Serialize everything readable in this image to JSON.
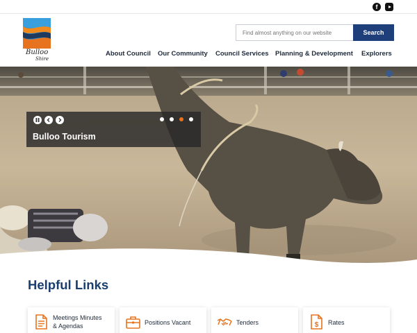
{
  "social": {
    "facebook_icon": "facebook-icon",
    "youtube_icon": "youtube-icon"
  },
  "header": {
    "logo_line1": "Bulloo",
    "logo_line2": "Shire",
    "search": {
      "placeholder": "Find almost anything on our website",
      "button_label": "Search"
    },
    "nav": [
      "About Council",
      "Our Community",
      "Council Services",
      "Planning & Development",
      "Explorers"
    ]
  },
  "hero": {
    "slide_title": "Bulloo Tourism",
    "controls": {
      "pause_icon": "pause-icon",
      "prev_icon": "chevron-left-icon",
      "next_icon": "chevron-right-icon"
    },
    "slide_count": 4,
    "active_slide": 3
  },
  "helpful_links": {
    "title": "Helpful Links",
    "cards": [
      {
        "line1": "Meetings Minutes",
        "line2": "& Agendas",
        "icon": "document-icon"
      },
      {
        "line1": "Positions Vacant",
        "line2": "",
        "icon": "briefcase-icon"
      },
      {
        "line1": "Tenders",
        "line2": "",
        "icon": "handshake-icon"
      },
      {
        "line1": "Rates",
        "line2": "",
        "icon": "dollar-document-icon"
      }
    ]
  },
  "colors": {
    "navy": "#1e3f7a",
    "accent_orange": "#e8731e",
    "title_blue": "#1a3f6e"
  }
}
